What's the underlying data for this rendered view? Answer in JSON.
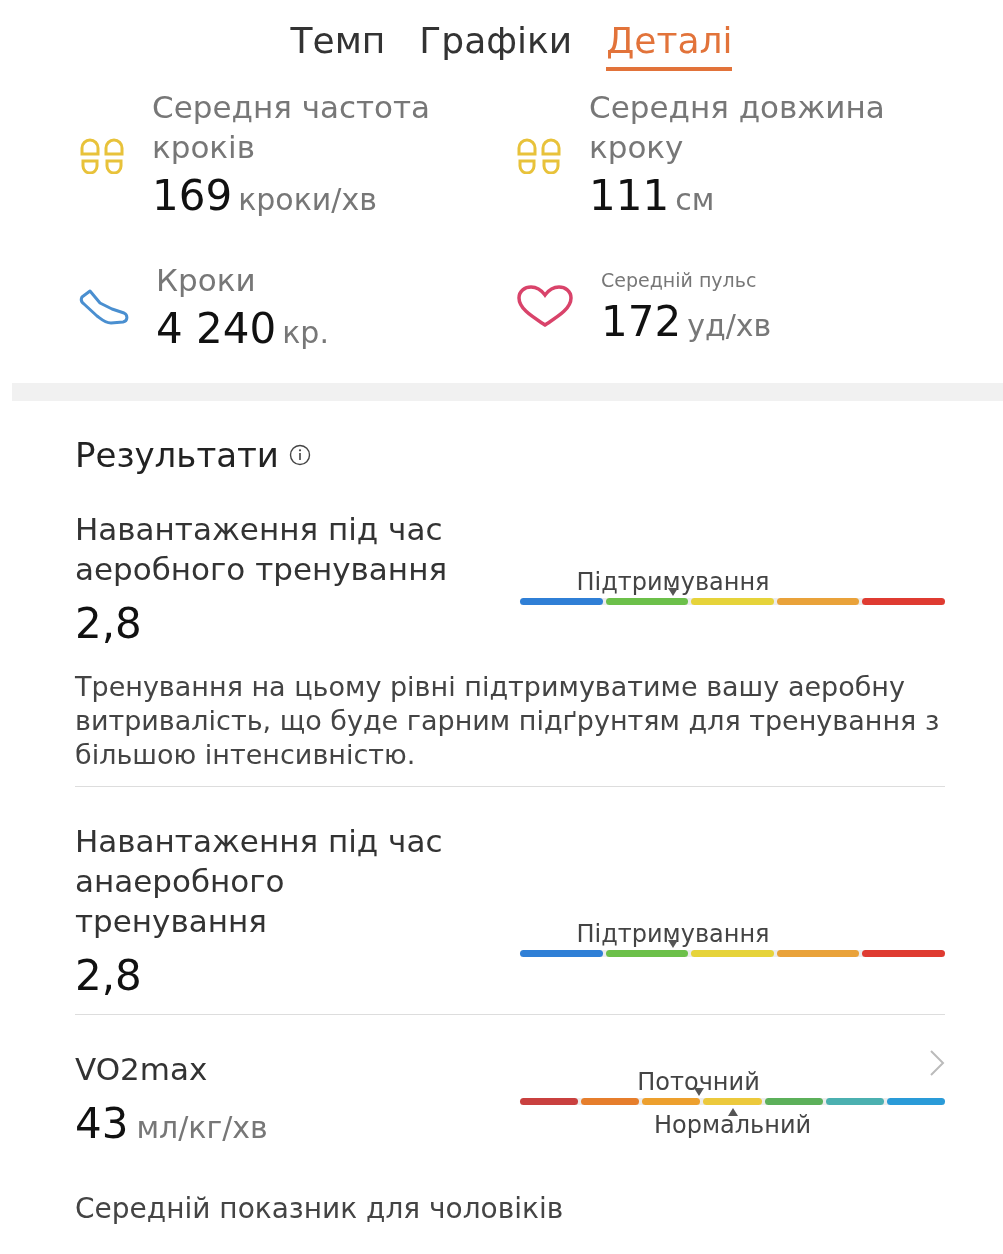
{
  "tabs": [
    {
      "label": "Темп",
      "selected": false
    },
    {
      "label": "Графіки",
      "selected": false
    },
    {
      "label": "Деталі",
      "selected": true
    }
  ],
  "stats": [
    {
      "kind": "footprints",
      "label": "Середня частота кроків",
      "value": "169",
      "unit": "кроки/хв"
    },
    {
      "kind": "footprints",
      "label": "Середня довжина кроку",
      "value": "111",
      "unit": "см"
    },
    {
      "kind": "shoe",
      "label": "Кроки",
      "value": "4 240",
      "unit": "кр."
    },
    {
      "kind": "heart",
      "label": "Середній пульс",
      "value": "172",
      "unit": "уд/хв"
    }
  ],
  "results": {
    "title": "Результати",
    "items": [
      {
        "title": "Навантаження під час аеробного тренування",
        "value": "2,8",
        "link": false,
        "segments": [
          {
            "color": "#2f7fd6"
          },
          {
            "color": "#6cc04a"
          },
          {
            "color": "#e6d33a"
          },
          {
            "color": "#e9a23a"
          },
          {
            "color": "#df3b31"
          }
        ],
        "marker_above": {
          "label": "Підтримування",
          "level": 0.36
        },
        "description": "Тренування на цьому рівні підтримуватиме вашу аеробну витривалість, що буде гарним підґрунтям для тренування з більшою інтенсивністю."
      },
      {
        "title": "Навантаження під час анаеробного тренування",
        "value": "2,8",
        "link": false,
        "segments": [
          {
            "color": "#2f7fd6"
          },
          {
            "color": "#6cc04a"
          },
          {
            "color": "#e6d33a"
          },
          {
            "color": "#e9a23a"
          },
          {
            "color": "#df3b31"
          }
        ],
        "marker_above": {
          "label": "Підтримування",
          "level": 0.36
        }
      },
      {
        "title": "VO2max",
        "value": "43",
        "unit": "мл/кг/хв",
        "link": true,
        "segments": [
          {
            "color": "#c9403f"
          },
          {
            "color": "#e67e2c"
          },
          {
            "color": "#eda02e"
          },
          {
            "color": "#ecc93c"
          },
          {
            "color": "#5cb05a"
          },
          {
            "color": "#4bb0b0"
          },
          {
            "color": "#2a9bd8"
          }
        ],
        "marker_above": {
          "label": "Поточний",
          "level": 0.42
        },
        "marker_below": {
          "label": "Нормальний",
          "level": 0.5
        }
      }
    ]
  },
  "footnote": "Середній показник для чоловіків"
}
